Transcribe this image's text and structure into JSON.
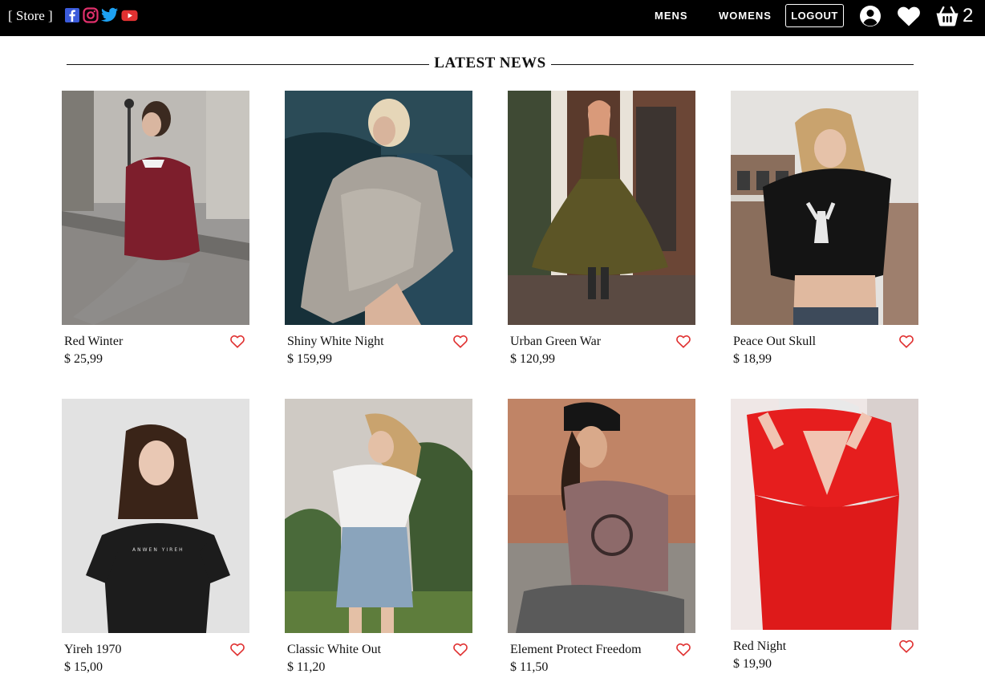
{
  "header": {
    "brand": "[ Store ]",
    "social_icons": [
      "facebook-icon",
      "instagram-icon",
      "twitter-icon",
      "youtube-icon"
    ],
    "nav": [
      "MENS",
      "WOMENS"
    ],
    "logout_label": "LOGOUT",
    "cart_count": "2",
    "colors": {
      "background": "#000000",
      "facebook": "#3b5bdb",
      "instagram": "#e1306c",
      "twitter": "#1da1f2",
      "youtube": "#e03131"
    }
  },
  "section": {
    "title": "LATEST NEWS"
  },
  "products": [
    {
      "name": "Red Winter",
      "price": "$ 25,99",
      "image": "woman-red-sweater-photo"
    },
    {
      "name": "Shiny White Night",
      "price": "$ 159,99",
      "image": "woman-sequin-dress-photo"
    },
    {
      "name": "Urban Green War",
      "price": "$ 120,99",
      "image": "woman-green-dress-photo"
    },
    {
      "name": "Peace Out Skull",
      "price": "$ 18,99",
      "image": "woman-skull-tee-photo"
    },
    {
      "name": "Yireh 1970",
      "price": "$ 15,00",
      "image": "woman-black-tee-photo"
    },
    {
      "name": "Classic White Out",
      "price": "$ 11,20",
      "image": "woman-white-top-photo"
    },
    {
      "name": "Element Protect Freedom",
      "price": "$ 11,50",
      "image": "woman-element-tee-photo"
    },
    {
      "name": "Red Night",
      "price": "$ 19,90",
      "image": "woman-red-dress-photo"
    }
  ],
  "colors": {
    "favorite": "#e03131"
  }
}
